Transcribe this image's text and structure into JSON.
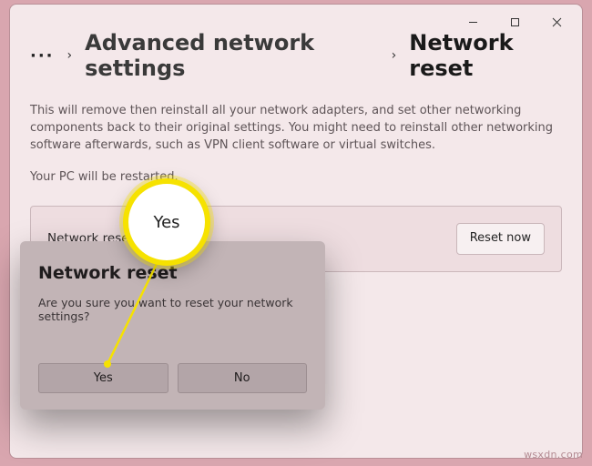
{
  "window_controls": {
    "min": "−",
    "max": "□",
    "close": "✕"
  },
  "breadcrumb": {
    "ellipsis": "···",
    "parent": "Advanced network settings",
    "current": "Network reset"
  },
  "description": "This will remove then reinstall all your network adapters, and set other networking components back to their original settings. You might need to reinstall other networking software afterwards, such as VPN client software or virtual switches.",
  "restart_notice": "Your PC will be restarted.",
  "card": {
    "label": "Network reset",
    "button": "Reset now"
  },
  "dialog": {
    "title": "Network reset",
    "message": "Are you sure you want to reset your network settings?",
    "yes": "Yes",
    "no": "No"
  },
  "highlight": {
    "zoom_label": "Yes"
  },
  "watermark": "wsxdn.com"
}
